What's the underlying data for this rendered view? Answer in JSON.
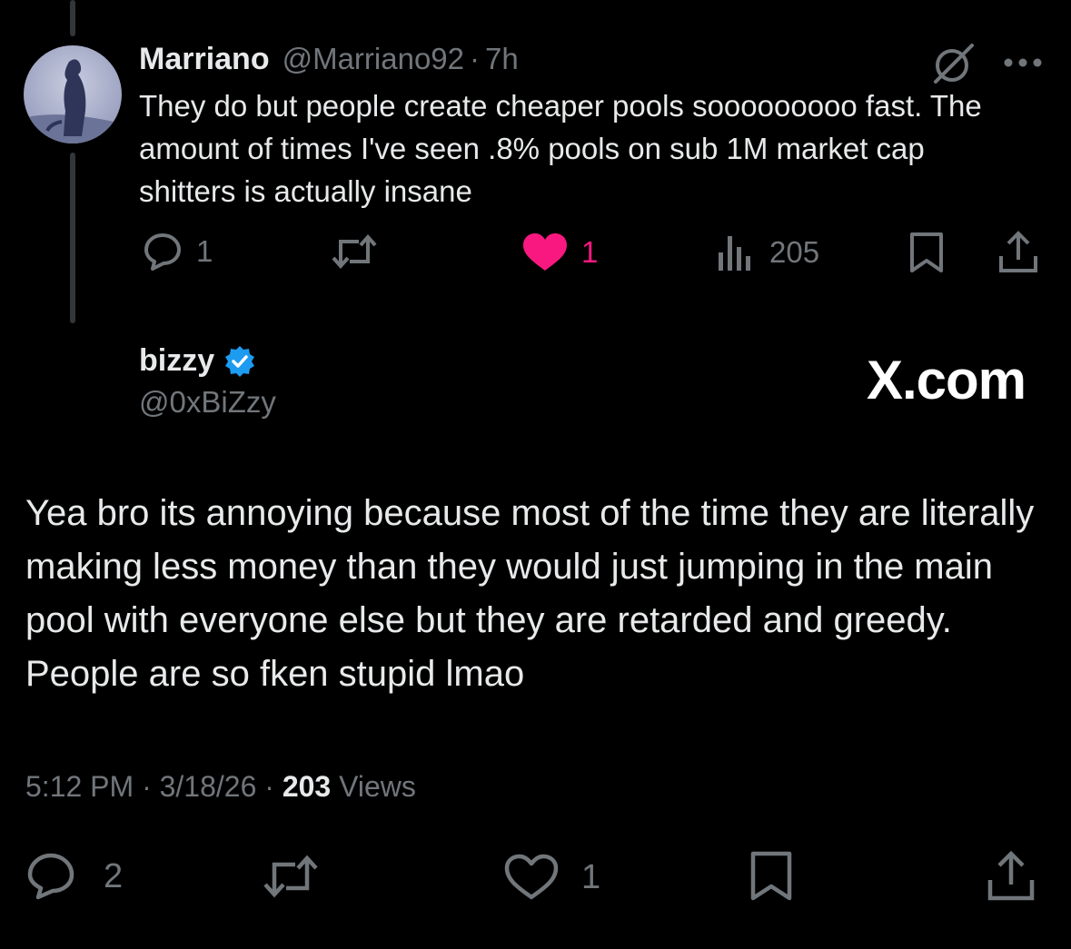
{
  "reply": {
    "author_name": "Marriano",
    "author_handle": "@Marriano92",
    "separator": "·",
    "time_ago": "7h",
    "text": "They do but people create cheaper pools sooooooooo fast. The amount of times I've seen .8% pools on sub 1M market cap shitters is actually insane",
    "actions": {
      "replies": "1",
      "likes": "1",
      "views": "205"
    },
    "like_color": "#f91880"
  },
  "main_post": {
    "author_name": "bizzy",
    "author_handle": "@0xBiZzy",
    "verified": true,
    "verified_color": "#1d9bf0",
    "watermark": "X.com",
    "text": "Yea bro its annoying because most of the time they are literally making less money than they would just jumping in the main pool with everyone else but they are retarded and greedy. People are so fken stupid lmao",
    "time": "5:12 PM",
    "date": "3/18/26",
    "views_count": "203",
    "views_label": "Views",
    "separator": "·",
    "actions": {
      "replies": "2",
      "likes": "1"
    }
  },
  "icons": [
    "reply-icon",
    "retweet-icon",
    "like-icon",
    "views-icon",
    "bookmark-icon",
    "share-icon",
    "grok-icon",
    "more-icon",
    "verified-badge-icon"
  ]
}
